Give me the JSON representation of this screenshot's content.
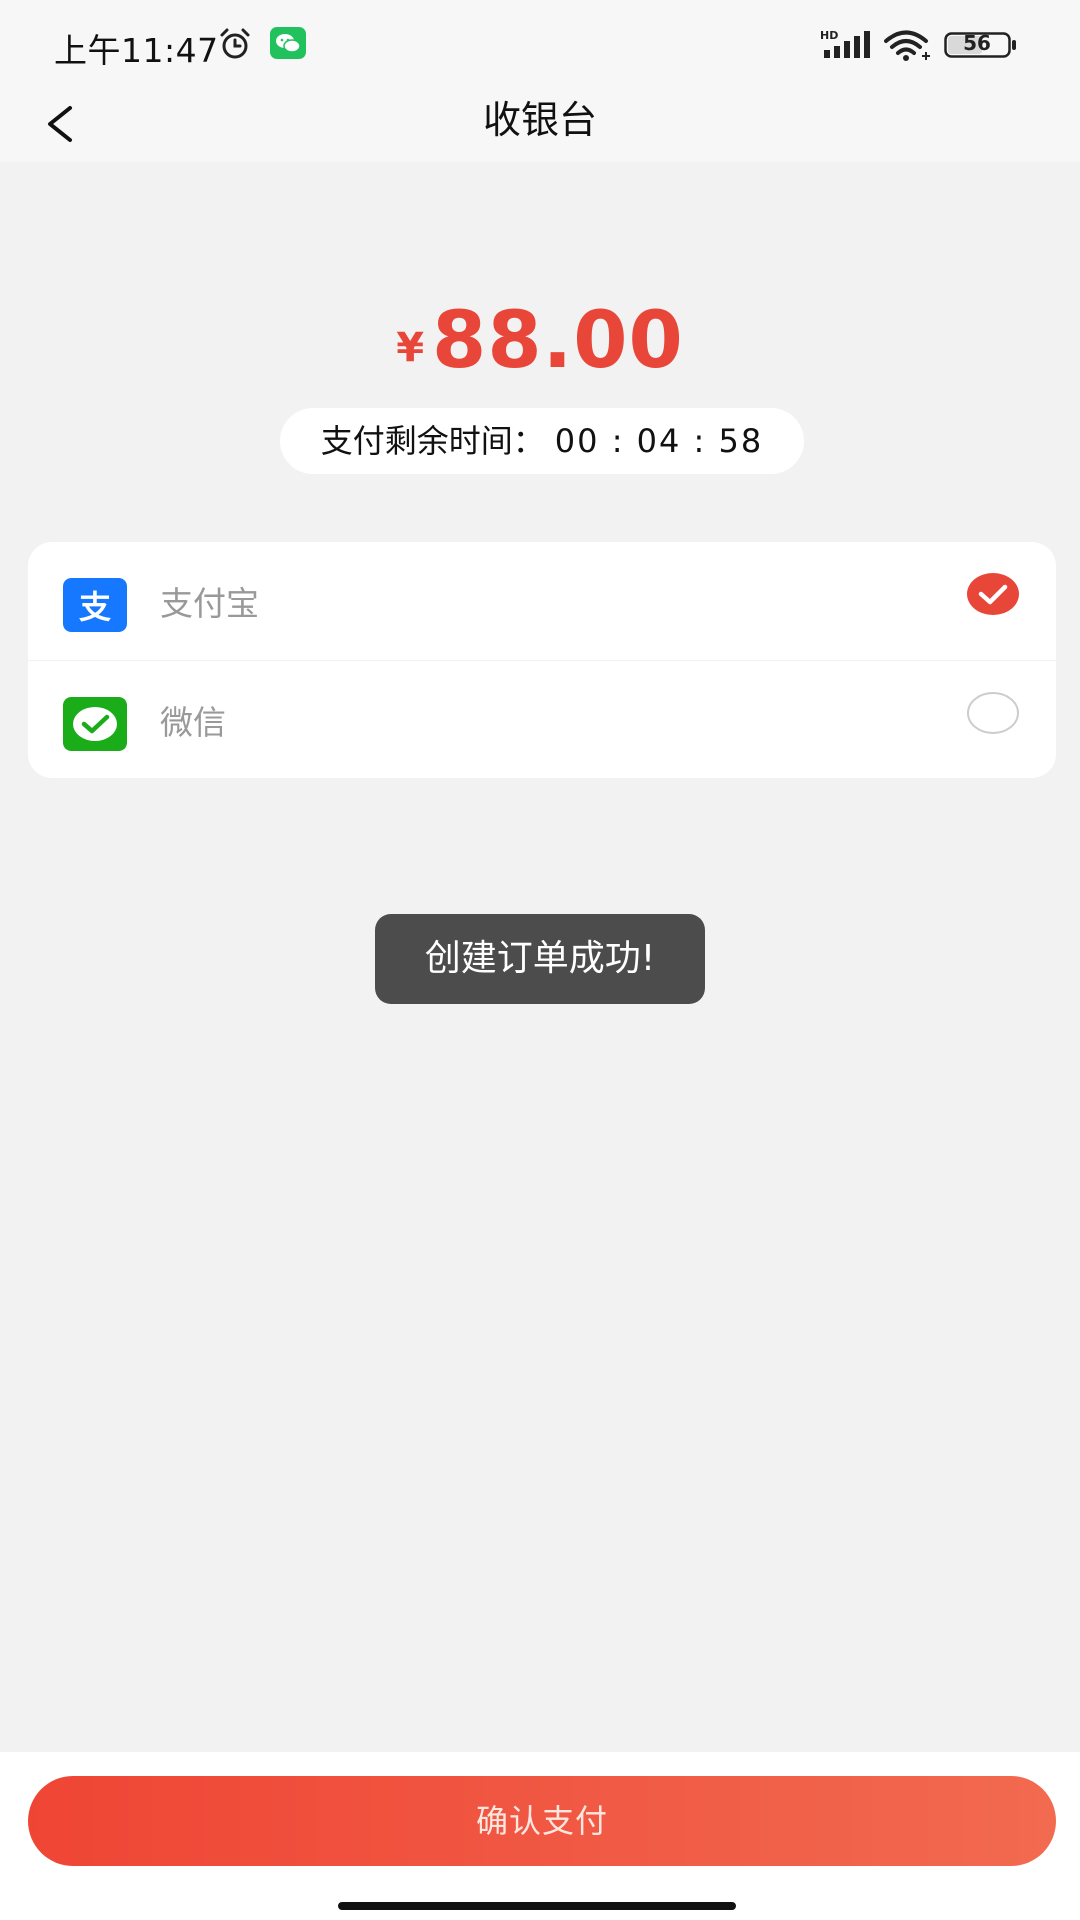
{
  "status_bar": {
    "time": "上午11:47",
    "battery": "56",
    "icons": [
      "alarm-icon",
      "wechat-notification-icon",
      "hd-signal-icon",
      "wifi-icon",
      "battery-icon"
    ]
  },
  "nav": {
    "title": "收银台",
    "back_icon": "chevron-left-icon"
  },
  "amount": {
    "currency": "¥",
    "value": "88.00"
  },
  "countdown": {
    "label": "支付剩余时间：",
    "time": "00 : 04 : 58"
  },
  "payment_methods": [
    {
      "label": "支付宝",
      "icon": "alipay-icon",
      "selected": true
    },
    {
      "label": "微信",
      "icon": "wechat-pay-icon",
      "selected": false
    }
  ],
  "toast": {
    "message": "创建订单成功!"
  },
  "confirm": {
    "label": "确认支付"
  },
  "colors": {
    "accent": "#e9463a",
    "alipay": "#1677ff",
    "wechat": "#1aad19",
    "background": "#f2f2f2"
  }
}
